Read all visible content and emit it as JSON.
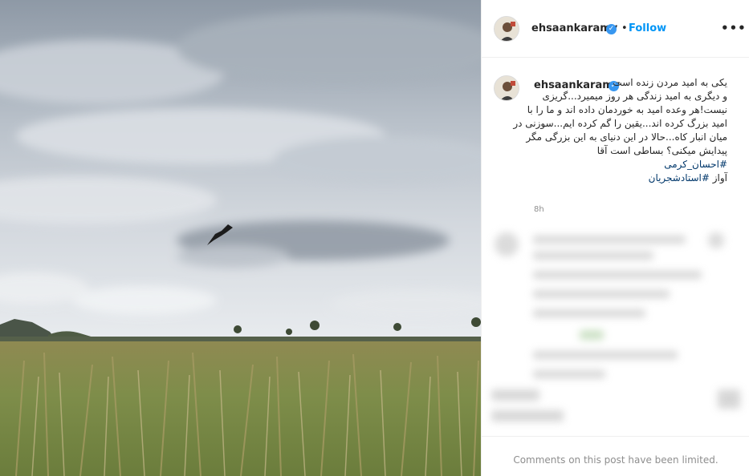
{
  "post": {
    "username": "ehsaankaramy",
    "verified_icon": "verified-badge-icon",
    "dot": "•",
    "follow_label": "Follow",
    "more_icon": "more-options-icon",
    "more_glyph": "•••"
  },
  "caption": {
    "username": "ehsaankaramy",
    "lines": [
      "یکی به امید مردن زنده است",
      "و دیگری به امید زندگی هر روز میمیرد...گریزی",
      "نیست!هر وعده امید به خوردمان داده اند و ما را با",
      "امید بزرگ کرده اند...یقین را گم کرده ایم...سوزنی در",
      "میان انبار کاه...حالا در این دنیای به این بزرگی مگر",
      "پیدایش میکنی؟ بساطی است آقا"
    ],
    "hashtag_line": "#احسان_کرمی",
    "last_line_prefix": "آواز ",
    "last_line_hashtag": "#استادشجریان",
    "timestamp": "8h"
  },
  "footer": {
    "comments_limited": "Comments on this post have been limited."
  },
  "colors": {
    "accent": "#0095f6",
    "hashtag": "#00376b",
    "muted": "#8e8e8e",
    "text": "#262626"
  }
}
